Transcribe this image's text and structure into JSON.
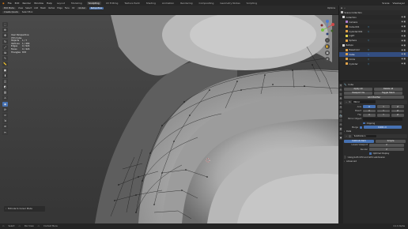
{
  "app": {
    "menu": [
      "File",
      "Edit",
      "Render",
      "Window",
      "Help"
    ],
    "workspaces": [
      "Layout",
      "Modeling",
      "Sculpting",
      "UV Editing",
      "Texture Paint",
      "Shading",
      "Animation",
      "Rendering",
      "Compositing",
      "Geometry Nodes",
      "Scripting"
    ],
    "active_workspace": "Sculpting",
    "scene_label": "Scene",
    "view_layer_label": "ViewLayer"
  },
  "header": {
    "mode": "Edit Mode",
    "menus": [
      "View",
      "Select",
      "Add",
      "Mesh",
      "Vertex",
      "Edge",
      "Face",
      "UV"
    ],
    "transform": "Global",
    "snap_label": "Retopoflow",
    "row2": [
      "Create Quads",
      "Select Box"
    ],
    "options_label": "Options"
  },
  "viewport": {
    "title": "User Perspective",
    "subtitle": "(53) Cube",
    "stats": [
      {
        "label": "Objects",
        "value": "1 / 7"
      },
      {
        "label": "Vertices",
        "value": "1 / 484"
      },
      {
        "label": "Edges",
        "value": "0 / 924"
      },
      {
        "label": "Faces",
        "value": "0 / 424"
      },
      {
        "label": "Triangles",
        "value": "833"
      }
    ]
  },
  "toolbar": {
    "tools": [
      "select-icon",
      "cursor-icon",
      "move-icon",
      "rotate-icon",
      "scale-icon",
      "transform-icon",
      "annotate-icon",
      "measure-icon",
      "add-cube-icon",
      "extrude-icon",
      "inset-icon",
      "bevel-icon",
      "loopcut-icon",
      "knife-icon",
      "polybuild-icon",
      "spin-icon",
      "smooth-icon",
      "shrink-icon",
      "shear-icon",
      "rip-icon"
    ],
    "active_index": 14
  },
  "operator_panel": {
    "label": "Extrude to Cursor Mode"
  },
  "status_bar": {
    "items": [
      "Select",
      "Pan View",
      "Context Menu"
    ],
    "version": "4.1.0 Alpha"
  },
  "outliner": {
    "title": "Scene Collection",
    "items": [
      {
        "name": "Collection",
        "type": "collection",
        "selected": false
      },
      {
        "name": "Camera",
        "type": "camera",
        "selected": false
      },
      {
        "name": "Cube.001",
        "type": "mesh",
        "selected": false
      },
      {
        "name": "Cylinder.001",
        "type": "mesh",
        "selected": false
      },
      {
        "name": "Light",
        "type": "light",
        "selected": false
      },
      {
        "name": "Sphere",
        "type": "mesh",
        "selected": false
      },
      {
        "name": "Retopo",
        "type": "collection",
        "selected": false
      },
      {
        "name": "BaseColor",
        "type": "mesh",
        "selected": false
      },
      {
        "name": "Cube",
        "type": "mesh",
        "selected": true
      },
      {
        "name": "Circle",
        "type": "mesh",
        "selected": false
      },
      {
        "name": "Cylinder",
        "type": "mesh",
        "selected": false
      }
    ]
  },
  "properties": {
    "object_name": "Cube",
    "modifier_header": "Add Modifier",
    "apply_label": "Apply All",
    "delete_all": "Delete All",
    "viewport_vis": "Viewport Vis",
    "toggle_stack": "Toggle Stack",
    "mirror": {
      "name": "Mirror",
      "axis_label": "Axis",
      "bisect_label": "Bisect",
      "flip_label": "Flip",
      "axes": [
        "X",
        "Y",
        "Z"
      ],
      "mirror_object_label": "Mirror Object",
      "clipping_label": "Clipping",
      "merge_label": "Merge",
      "merge_value": "0.001 m",
      "data_label": "Data"
    },
    "subdivision": {
      "name": "Subdivision",
      "catmull": "Catmull-Clark",
      "simple": "Simple",
      "levels_viewport_label": "Levels Viewport",
      "levels_viewport": "2",
      "render_label": "Render",
      "render_value": "2",
      "optimal_label": "Optimal Display",
      "gpu_note": "Using both CPU and GPU subdivision",
      "advanced_label": "Advanced"
    },
    "colors": {
      "accent": "#4772b3"
    }
  }
}
